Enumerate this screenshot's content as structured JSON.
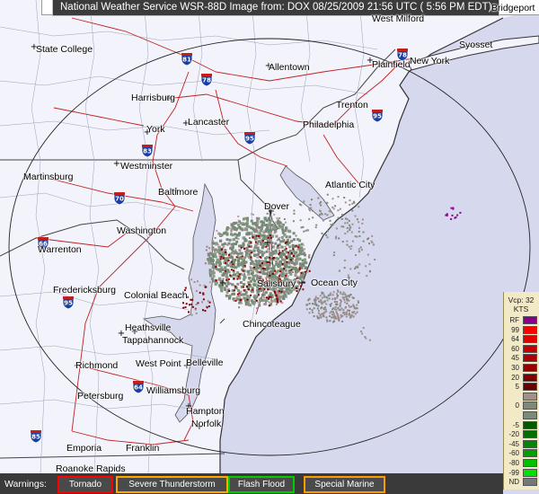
{
  "title": "National Weather Service WSR-88D Image from: DOX 08/25/2009 21:56 UTC ( 5:56 PM EDT)",
  "cities": [
    {
      "name": "West Milford"
    },
    {
      "name": "Bridgeport"
    },
    {
      "name": "State College"
    },
    {
      "name": "Syosset"
    },
    {
      "name": "Allentown"
    },
    {
      "name": "Plainfield"
    },
    {
      "name": "New York"
    },
    {
      "name": "Harrisburg"
    },
    {
      "name": "Trenton"
    },
    {
      "name": "Lancaster"
    },
    {
      "name": "Philadelphia"
    },
    {
      "name": "York"
    },
    {
      "name": "Westminster"
    },
    {
      "name": "Martinsburg"
    },
    {
      "name": "Baltimore"
    },
    {
      "name": "Atlantic City"
    },
    {
      "name": "Dover"
    },
    {
      "name": "Washington"
    },
    {
      "name": "Warrenton"
    },
    {
      "name": "Salisbury"
    },
    {
      "name": "Ocean City"
    },
    {
      "name": "Fredericksburg"
    },
    {
      "name": "Colonial Beach"
    },
    {
      "name": "Chincoteague"
    },
    {
      "name": "Heathsville"
    },
    {
      "name": "Tappahannock"
    },
    {
      "name": "Richmond"
    },
    {
      "name": "West Point"
    },
    {
      "name": "Belleville"
    },
    {
      "name": "Williamsburg"
    },
    {
      "name": "Petersburg"
    },
    {
      "name": "Hampton"
    },
    {
      "name": "Norfolk"
    },
    {
      "name": "Emporia"
    },
    {
      "name": "Franklin"
    },
    {
      "name": "Roanoke Rapids"
    }
  ],
  "interstates": [
    "81",
    "78",
    "95",
    "83",
    "70",
    "66",
    "95",
    "64",
    "85",
    "95",
    "78"
  ],
  "legend": {
    "top_label": "Vcp: 32",
    "unit": "KTS",
    "rows": [
      {
        "label": "RF",
        "color": "#8a008a"
      },
      {
        "label": "99",
        "color": "#ff0000"
      },
      {
        "label": "64",
        "color": "#e00000"
      },
      {
        "label": "60",
        "color": "#c40000"
      },
      {
        "label": "45",
        "color": "#b00000"
      },
      {
        "label": "30",
        "color": "#960000"
      },
      {
        "label": "20",
        "color": "#800000"
      },
      {
        "label": "5",
        "color": "#6a0000"
      },
      {
        "label": "",
        "color": "#a0908c"
      },
      {
        "label": "0",
        "color": "#7c8a7c"
      },
      {
        "label": "",
        "color": "#788c78"
      },
      {
        "label": "-5",
        "color": "#005a00"
      },
      {
        "label": "-20",
        "color": "#007000"
      },
      {
        "label": "-45",
        "color": "#008800"
      },
      {
        "label": "-60",
        "color": "#00a000"
      },
      {
        "label": "-80",
        "color": "#00c000"
      },
      {
        "label": "-99",
        "color": "#00e000"
      },
      {
        "label": "ND",
        "color": "#777777"
      }
    ]
  },
  "warnings": {
    "label": "Warnings:",
    "items": [
      {
        "label": "Tornado",
        "color": "#ff0000"
      },
      {
        "label": "Severe Thunderstorm",
        "color": "#ffa500"
      },
      {
        "label": "Flash Flood",
        "color": "#00cc00"
      },
      {
        "label": "Special Marine",
        "color": "#ff9900"
      }
    ]
  }
}
